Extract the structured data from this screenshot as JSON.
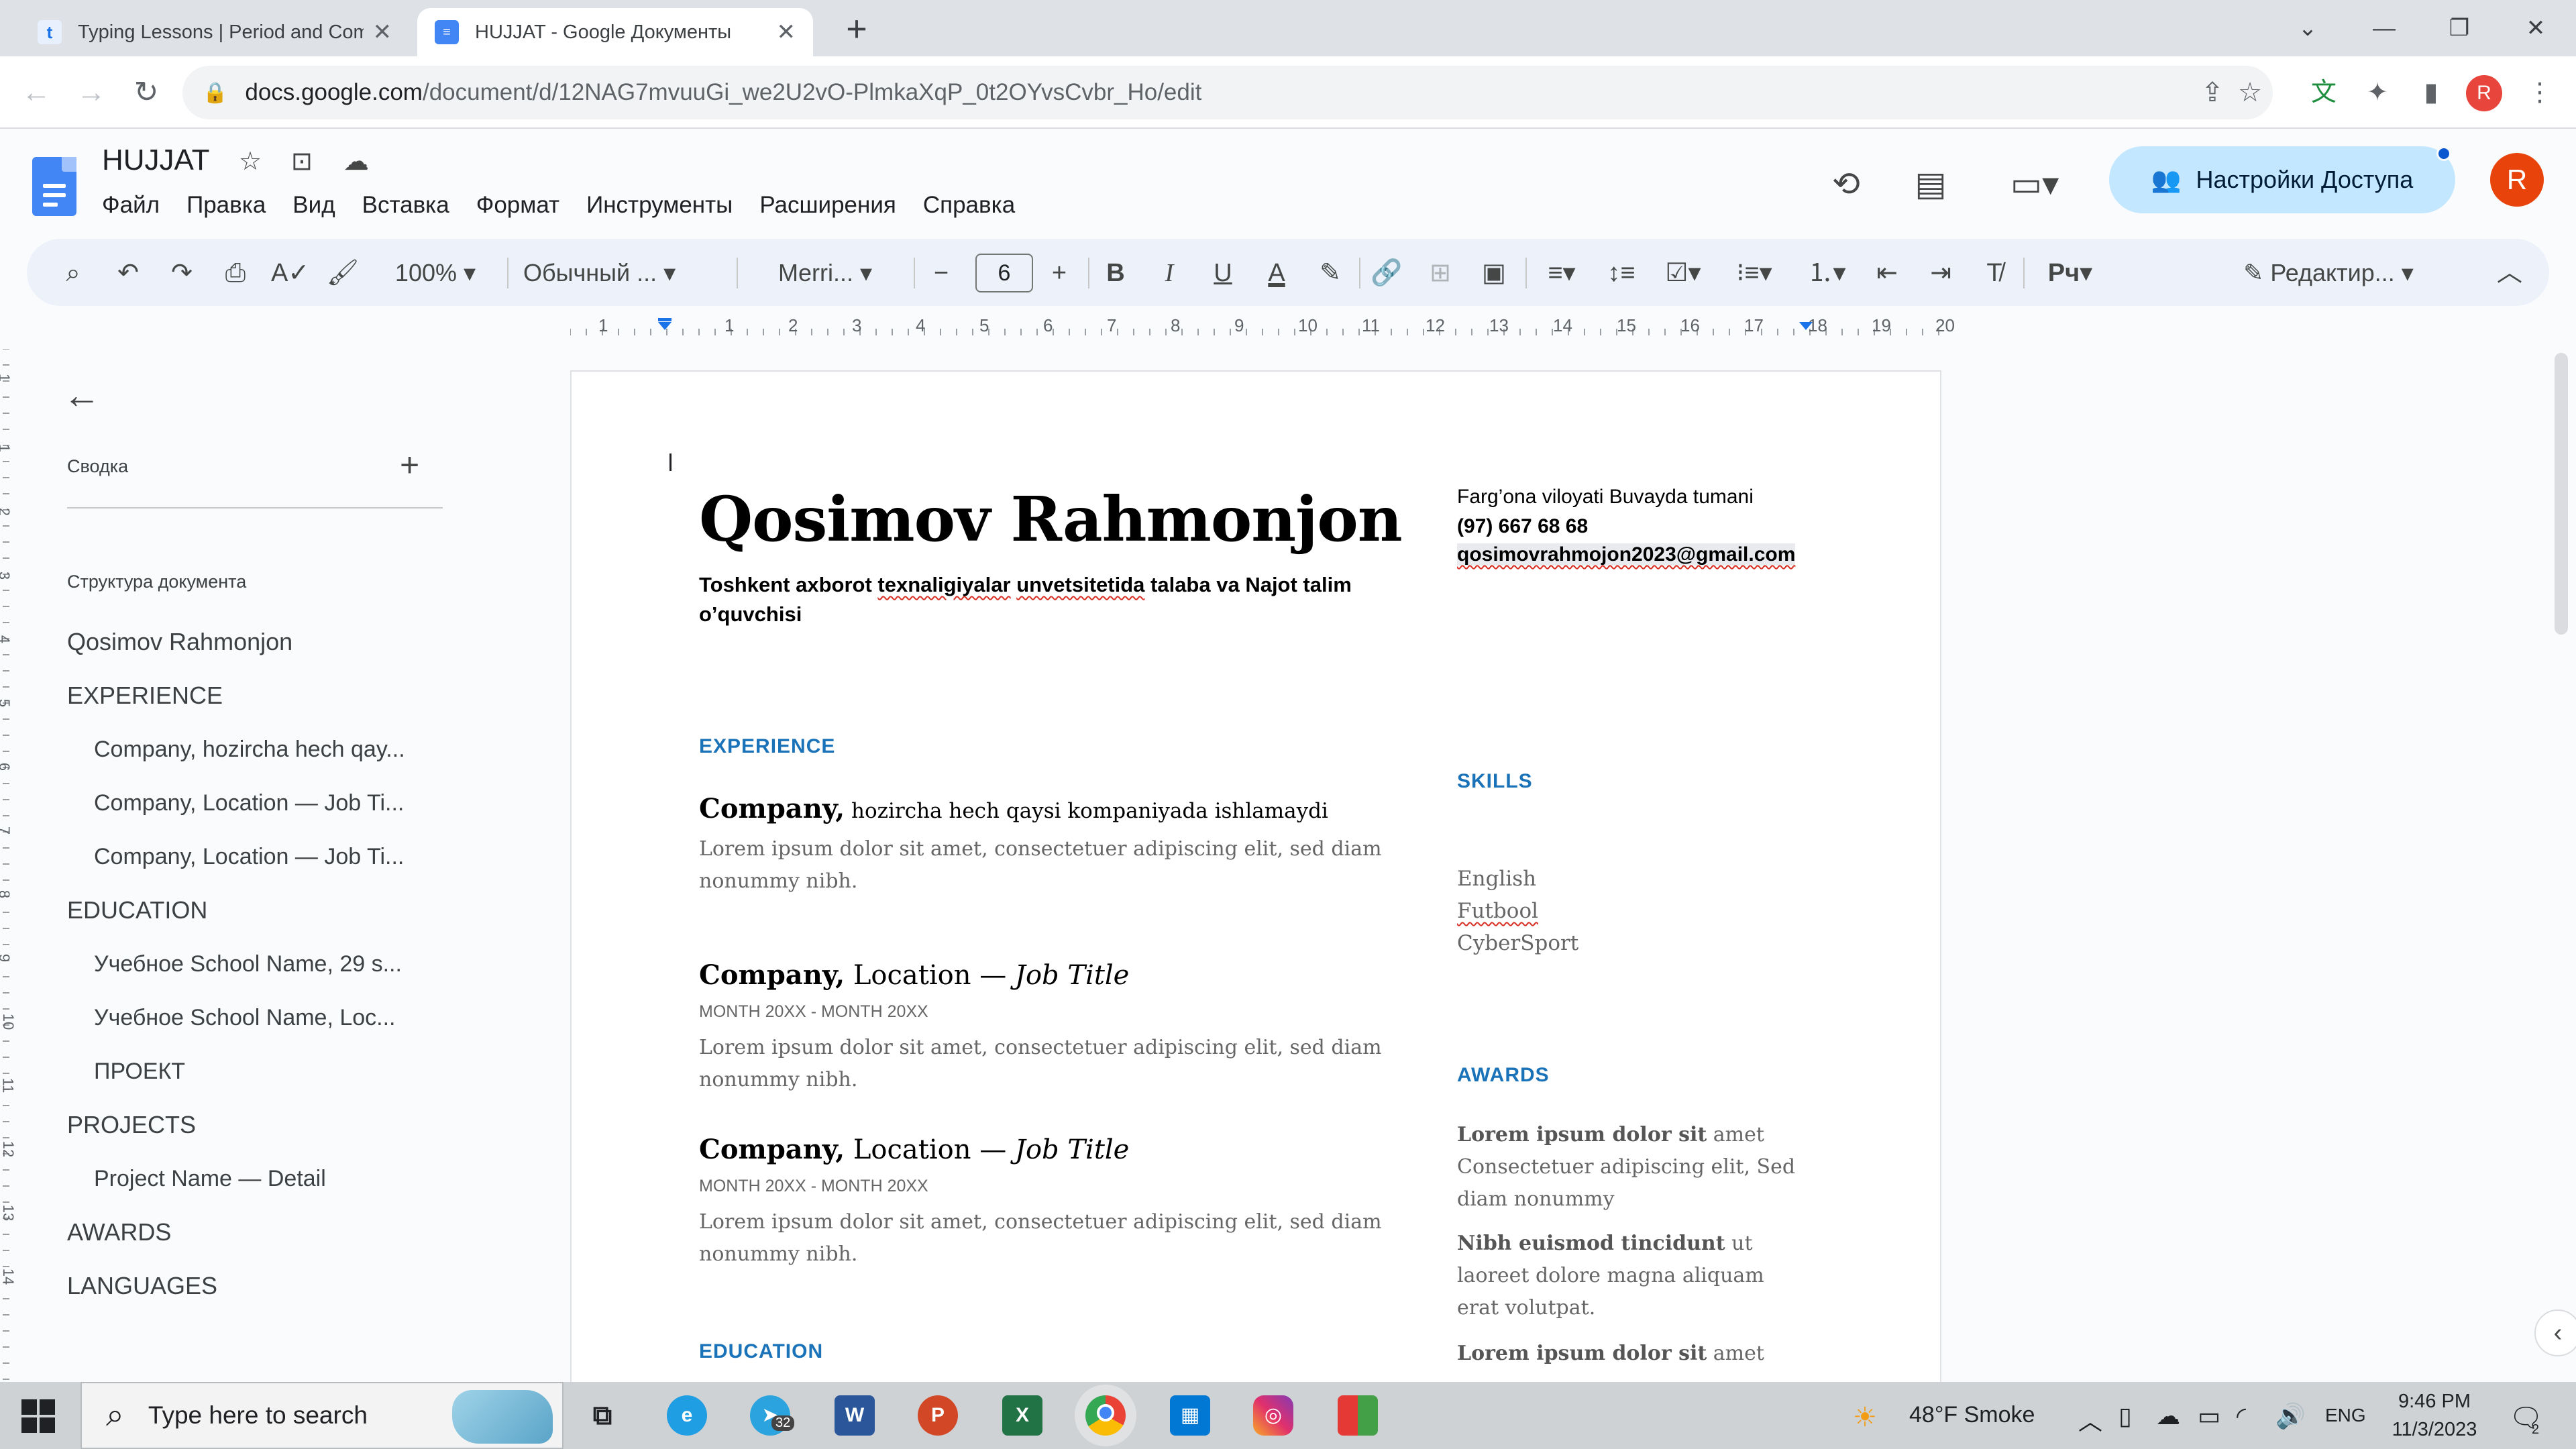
{
  "browser": {
    "tabs": [
      {
        "title": "Typing Lessons | Period and Com",
        "favicon": "t",
        "active": false
      },
      {
        "title": "HUJJAT - Google Документы",
        "favicon": "docs-icon",
        "active": true
      }
    ],
    "url_host": "docs.google.com",
    "url_path": "/document/d/12NAG7mvuuGi_we2U2vO-PlmkaXqP_0t2OYvsCvbr_Ho/edit",
    "profile_initial": "R"
  },
  "doc": {
    "title": "HUJJAT",
    "menu": [
      "Файл",
      "Правка",
      "Вид",
      "Вставка",
      "Формат",
      "Инструменты",
      "Расширения",
      "Справка"
    ],
    "share_label": "Настройки Доступа",
    "account_initial": "R"
  },
  "toolbar": {
    "zoom": "100%",
    "style": "Обычный ...",
    "font": "Merri...",
    "font_size": "6",
    "edit_mode": "Редактир..."
  },
  "ruler": {
    "h_ticks": [
      "1",
      "1",
      "2",
      "3",
      "4",
      "5",
      "6",
      "7",
      "8",
      "9",
      "10",
      "11",
      "12",
      "13",
      "14",
      "15",
      "16",
      "17",
      "18",
      "19",
      "20"
    ],
    "v_ticks": [
      "1",
      "1",
      "2",
      "3",
      "4",
      "5",
      "6",
      "7",
      "8",
      "9",
      "10",
      "11",
      "12",
      "13",
      "14"
    ]
  },
  "outline": {
    "summary_label": "Сводка",
    "structure_label": "Структура документа",
    "items": [
      {
        "label": "Qosimov Rahmonjon",
        "level": 1
      },
      {
        "label": "EXPERIENCE",
        "level": 1
      },
      {
        "label": "Company, hozircha hech qay...",
        "level": 2
      },
      {
        "label": "Company, Location — Job Ti...",
        "level": 2
      },
      {
        "label": "Company, Location — Job Ti...",
        "level": 2
      },
      {
        "label": "EDUCATION",
        "level": 1
      },
      {
        "label": "Учебное School Name, 29 s...",
        "level": 2
      },
      {
        "label": "Учебное School Name, Loc...",
        "level": 2
      },
      {
        "label": "ПРОЕКТ",
        "level": 2
      },
      {
        "label": "PROJECTS",
        "level": 1
      },
      {
        "label": "Project Name — Detail",
        "level": 2
      },
      {
        "label": "AWARDS",
        "level": 1
      },
      {
        "label": "LANGUAGES",
        "level": 1
      }
    ]
  },
  "resume": {
    "name": "Qosimov Rahmonjon",
    "subtitle_parts": [
      "Toshkent axborot ",
      "texnaligiyalar",
      " ",
      "unvetsitetida",
      " talaba va Najot talim o’quvchisi"
    ],
    "address": "Farg’ona viloyati Buvayda tumani",
    "phone": "(97) 667 68 68",
    "email": "qosimovrahmojon2023@gmail.com",
    "experience_heading": "EXPERIENCE",
    "jobs": [
      {
        "company": "Company,",
        "detail": " hozircha hech qaysi kompaniyada ishlamaydi",
        "dates": "",
        "text": "Lorem ipsum dolor sit amet, consectetuer adipiscing elit, sed diam nonummy nibh."
      },
      {
        "company": "Company,",
        "location": " Location — ",
        "title": "Job Title",
        "dates": "MONTH 20XX - MONTH 20XX",
        "text": "Lorem ipsum dolor sit amet, consectetuer adipiscing elit, sed diam nonummy nibh."
      },
      {
        "company": "Company,",
        "location": " Location — ",
        "title": "Job Title",
        "dates": "MONTH 20XX - MONTH 20XX",
        "text": "Lorem ipsum dolor sit amet, consectetuer adipiscing elit, sed diam nonummy nibh."
      }
    ],
    "education_heading": "EDUCATION",
    "skills_heading": "SKILLS",
    "skills": [
      "English",
      "Futbool",
      "CyberSport"
    ],
    "awards_heading": "AWARDS",
    "awards": [
      {
        "bold": "Lorem ipsum dolor sit",
        "rest": " amet Consectetuer adipiscing elit, Sed diam nonummy"
      },
      {
        "bold": "Nibh euismod tincidunt",
        "rest": " ut laoreet dolore magna aliquam erat volutpat."
      },
      {
        "bold": "Lorem ipsum dolor sit",
        "rest": " amet"
      }
    ]
  },
  "taskbar": {
    "search_placeholder": "Type here to search",
    "telegram_badge": "32",
    "weather": "48°F  Smoke",
    "language": "ENG",
    "time": "9:46 PM",
    "date": "11/3/2023",
    "notification_count": "2"
  },
  "colors": {
    "accent_blue": "#1a73b8",
    "share_button": "#c2e7ff",
    "account": "#e8430a"
  }
}
